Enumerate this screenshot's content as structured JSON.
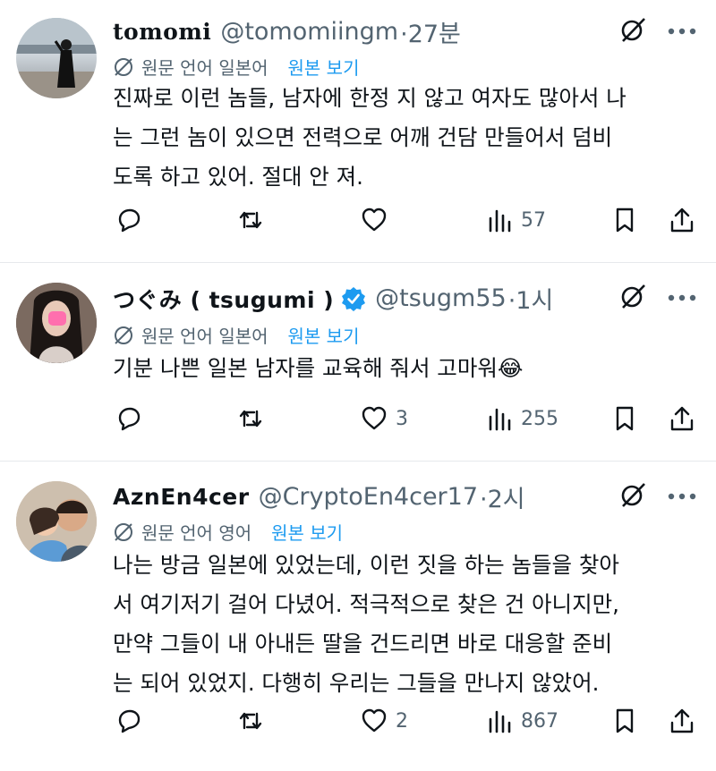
{
  "tweets": [
    {
      "name": "tomomi",
      "handle": "@tomomiingm",
      "time": "·27분",
      "verified": false,
      "translation_lang": "원문 언어 일본어",
      "show_original": "원본 보기",
      "text_lines": [
        "진짜로 이런 놈들, 남자에 한정 지 않고 여자도 많아서 나",
        "는 그런 놈이 있으면 전력으로 어깨 건담 만들어서 덤비",
        "도록 하고 있어. 절대 안 져."
      ],
      "replies": "",
      "retweets": "",
      "likes": "",
      "views": "57"
    },
    {
      "name": "つぐみ ( tsugumi )",
      "handle": "@tsugm55",
      "time": "·1시",
      "verified": true,
      "translation_lang": "원문 언어 일본어",
      "show_original": "원본 보기",
      "text_lines": [
        "기분 나쁜 일본 남자를 교육해 줘서 고마워😂"
      ],
      "replies": "",
      "retweets": "",
      "likes": "3",
      "views": "255"
    },
    {
      "name": "AznEn4cer",
      "handle": "@CryptoEn4cer17",
      "time": "·2시",
      "verified": false,
      "translation_lang": "원문 언어 영어",
      "show_original": "원본 보기",
      "text_lines": [
        "나는 방금 일본에 있었는데, 이런 짓을 하는 놈들을 찾아",
        "서 여기저기 걸어 다녔어. 적극적으로 찾은 건 아니지만,",
        "만약 그들이 내 아내든 딸을 건드리면 바로 대응할 준비",
        "는 되어 있었지. 다행히 우리는 그들을 만나지 않았어."
      ],
      "replies": "",
      "retweets": "",
      "likes": "2",
      "views": "867"
    }
  ],
  "icons": {
    "reply": "reply-icon",
    "retweet": "retweet-icon",
    "like": "heart-icon",
    "views": "views-icon",
    "bookmark": "bookmark-icon",
    "share": "share-icon",
    "translate": "globe-icon",
    "grok": "grok-icon",
    "more": "more-icon"
  },
  "colors": {
    "text": "#0f1419",
    "secondary": "#536471",
    "link": "#1d9bf0",
    "verified": "#1d9bf0",
    "divider": "#e6e9ec"
  }
}
